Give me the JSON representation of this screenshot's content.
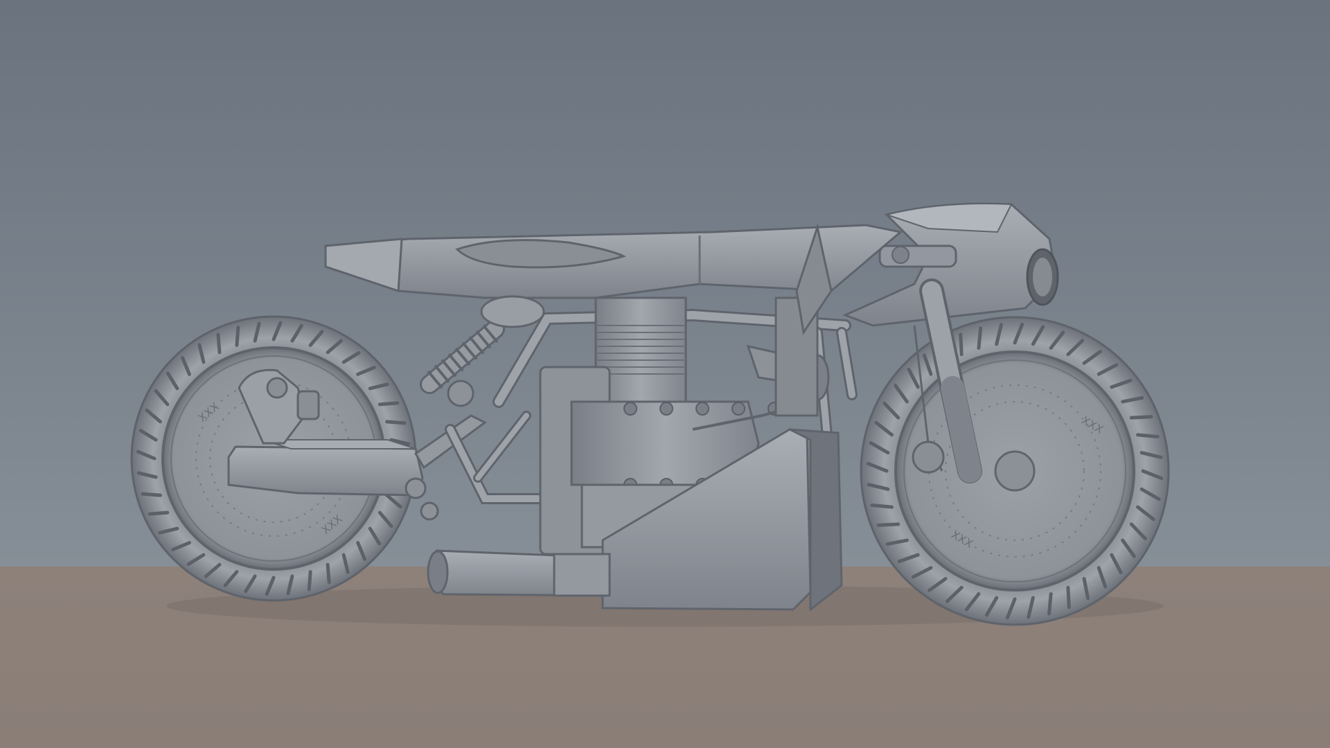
{
  "scene": {
    "description_colors": {
      "wall_top": "#6d7681",
      "wall_bottom": "#858d96",
      "floor": "#8b7f78",
      "model": "#8f949c",
      "model_dark": "#5f646c",
      "model_light": "#b9bec5"
    },
    "wheel_branding": "XXX"
  }
}
